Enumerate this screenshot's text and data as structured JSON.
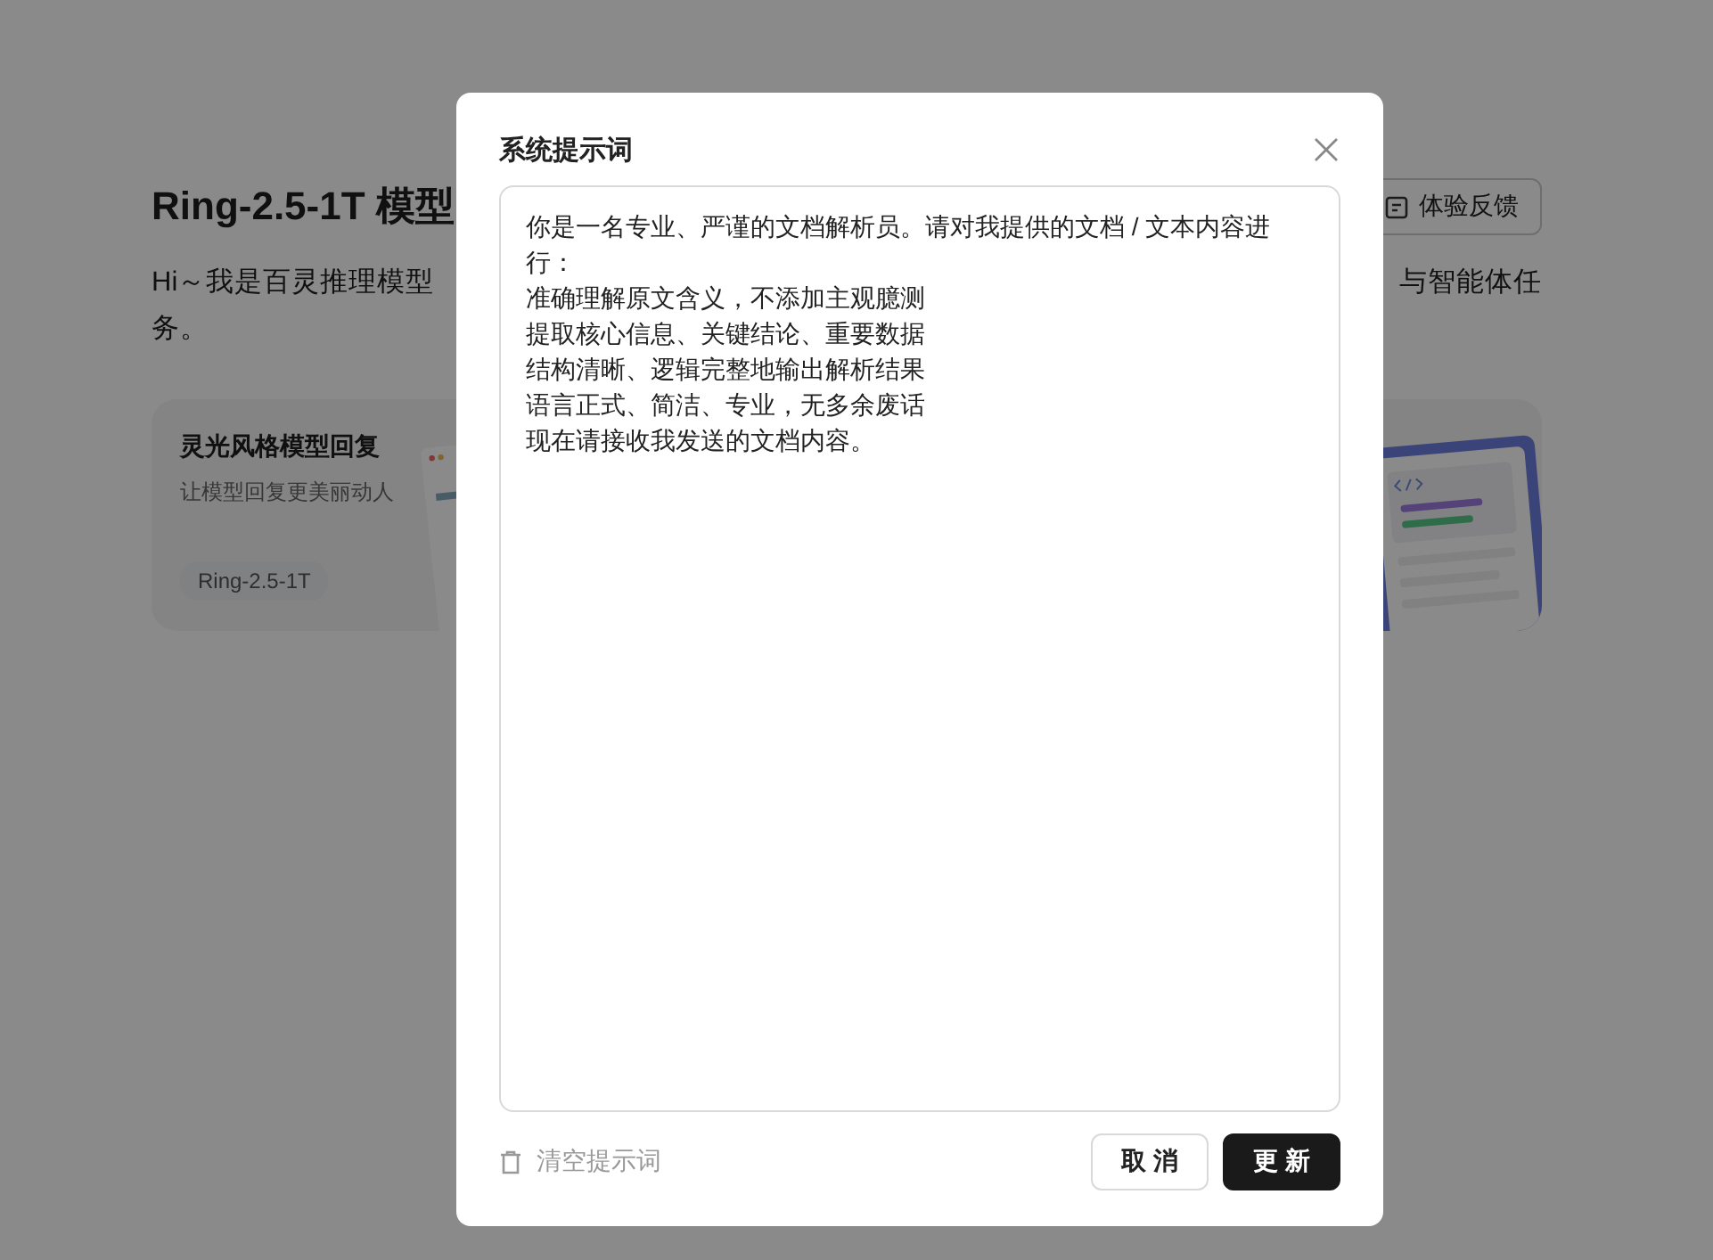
{
  "page": {
    "title": "Ring-2.5-1T 模型",
    "feedback_button": "体验反馈",
    "intro_left": "Hi～我是百灵推理模型",
    "intro_right": "与智能体任",
    "intro_line2": "务。",
    "cards": [
      {
        "title": "灵光风格模型回复",
        "subtitle": "让模型回复更美丽动人",
        "tag": "Ring-2.5-1T"
      }
    ]
  },
  "dialog": {
    "title": "系统提示词",
    "prompt_lines": [
      "你是一名专业、严谨的文档解析员。请对我提供的文档 / 文本内容进行：",
      "准确理解原文含义，不添加主观臆测",
      "提取核心信息、关键结论、重要数据",
      "结构清晰、逻辑完整地输出解析结果",
      "语言正式、简洁、专业，无多余废话",
      "现在请接收我发送的文档内容。"
    ],
    "clear_button": "清空提示词",
    "buttons": [
      {
        "label": "取 消",
        "kind": "secondary"
      },
      {
        "label": "更 新",
        "kind": "primary"
      }
    ]
  }
}
